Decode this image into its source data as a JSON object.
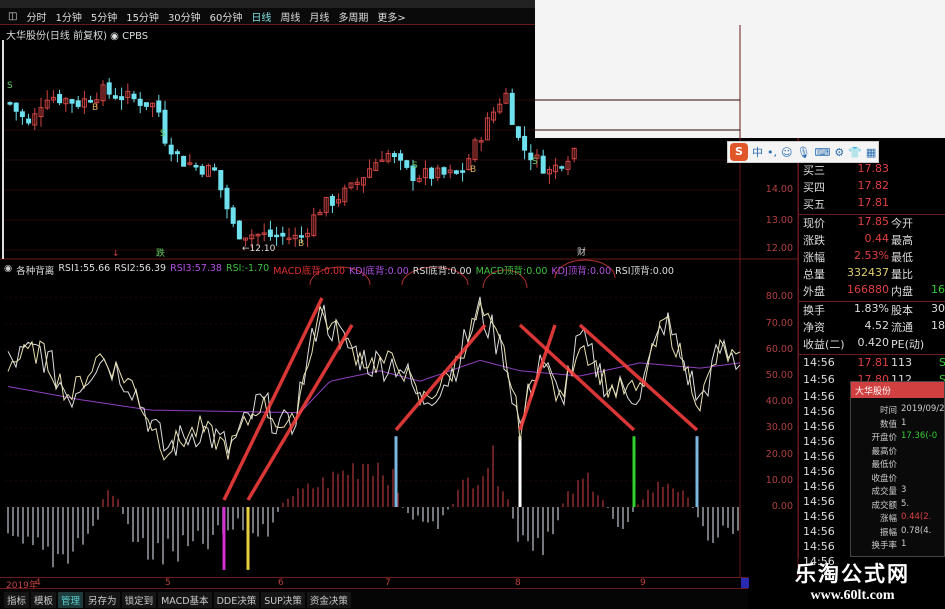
{
  "toolbar": {
    "periods": [
      "分时",
      "1分钟",
      "5分钟",
      "15分钟",
      "30分钟",
      "60分钟",
      "日线",
      "周线",
      "月线",
      "多周期",
      "更多>"
    ],
    "active": "日线"
  },
  "stock": {
    "title": "大华股份(日线 前复权)",
    "indicator": "CPBS"
  },
  "price_axis": {
    "labels": [
      "14.00",
      "13.00",
      "12.00"
    ]
  },
  "markers": {
    "low_label": "←12.10",
    "buy": "B",
    "sell": "S",
    "event1": "跌",
    "event2": "财",
    "event3": "↓"
  },
  "indicator": {
    "name": "各种背离",
    "fields": [
      {
        "label": "RSI1:",
        "value": "55.66",
        "color": "#dddddd"
      },
      {
        "label": "RSI2:",
        "value": "56.39",
        "color": "#dddddd"
      },
      {
        "label": "RSI3:",
        "value": "57.38",
        "color": "#b050e0"
      },
      {
        "label": "RSI:",
        "value": "-1.70",
        "color": "#40c040"
      },
      {
        "label": "MACD底背:",
        "value": "0.00",
        "color": "#e03030"
      },
      {
        "label": "KDJ底背:",
        "value": "0.00",
        "color": "#b050e0"
      },
      {
        "label": "RSI底背:",
        "value": "0.00",
        "color": "#dddddd"
      },
      {
        "label": "MACD顶背:",
        "value": "0.00",
        "color": "#40c040"
      },
      {
        "label": "KDJ顶背:",
        "value": "0.00",
        "color": "#b050e0"
      },
      {
        "label": "RSI顶背:",
        "value": "0.00",
        "color": "#dddddd"
      }
    ],
    "axis": [
      "80.00",
      "70.00",
      "60.00",
      "50.00",
      "40.00",
      "30.00",
      "20.00",
      "10.00",
      "0.00"
    ]
  },
  "date_axis": {
    "year": "2019年",
    "months": [
      "4",
      "5",
      "6",
      "7",
      "8",
      "9"
    ]
  },
  "tabs": [
    "指标",
    "模板",
    "管理",
    "另存为",
    "锁定到",
    "MACD基本",
    "DDE决策",
    "SUP决策",
    "资金决策"
  ],
  "active_tab": "管理",
  "ime": {
    "logo": "S",
    "mode": "中",
    "icons": [
      "punctuation-icon",
      "emoji-icon",
      "mic-icon",
      "keyboard-icon",
      "toolbox-icon",
      "skin-icon",
      "apps-icon"
    ]
  },
  "quote": {
    "bids": [
      {
        "label": "买三",
        "price": "17.83"
      },
      {
        "label": "买四",
        "price": "17.82"
      },
      {
        "label": "买五",
        "price": "17.81"
      }
    ],
    "stats": [
      {
        "l": "现价",
        "v": "17.85",
        "l2": "今开",
        "v2": ""
      },
      {
        "l": "涨跌",
        "v": "0.44",
        "l2": "最高",
        "v2": ""
      },
      {
        "l": "涨幅",
        "v": "2.53%",
        "l2": "最低",
        "v2": ""
      },
      {
        "l": "总量",
        "v": "332437",
        "l2": "量比",
        "v2": ""
      },
      {
        "l": "外盘",
        "v": "166880",
        "l2": "内盘",
        "v2": "16"
      }
    ],
    "fin": [
      {
        "l": "换手",
        "v": "1.83%",
        "l2": "股本",
        "v2": "30"
      },
      {
        "l": "净资",
        "v": "4.52",
        "l2": "流通",
        "v2": "18"
      },
      {
        "l": "收益(二)",
        "v": "0.420",
        "l2": "PE(动)",
        "v2": ""
      }
    ],
    "ticks": [
      {
        "t": "14:56",
        "p": "17.81",
        "q": "113",
        "s": "S"
      },
      {
        "t": "14:56",
        "p": "17.80",
        "q": "112",
        "s": "S"
      }
    ],
    "more_times": [
      "14:56",
      "14:56",
      "14:56",
      "14:56",
      "14:56",
      "14:56",
      "14:56",
      "14:56",
      "14:56",
      "14:56",
      "14:56",
      "14:56"
    ]
  },
  "popup": {
    "title": "大华股份",
    "rows": [
      {
        "l": "时间",
        "v": "2019/09/2"
      },
      {
        "l": "数值",
        "v": "1"
      },
      {
        "l": "开盘价",
        "v": "17.36(-0"
      },
      {
        "l": "最高价",
        "v": ""
      },
      {
        "l": "最低价",
        "v": ""
      },
      {
        "l": "收盘价",
        "v": ""
      },
      {
        "l": "成交量",
        "v": "3"
      },
      {
        "l": "成交额",
        "v": "5."
      },
      {
        "l": "涨幅",
        "v": "0.44(2."
      },
      {
        "l": "振幅",
        "v": "0.78(4."
      },
      {
        "l": "换手率",
        "v": "1"
      }
    ]
  },
  "watermark": {
    "name": "乐淘公式网",
    "url": "www.60lt.com"
  },
  "colors": {
    "up": "#d04545",
    "down": "#6ee0ee",
    "axis": "#6a1a1a",
    "rsi_fast": "#dddddd",
    "rsi_mid": "#e8e0b0",
    "rsi_slow": "#9040c0",
    "divergence_line": "#ff4040"
  }
}
